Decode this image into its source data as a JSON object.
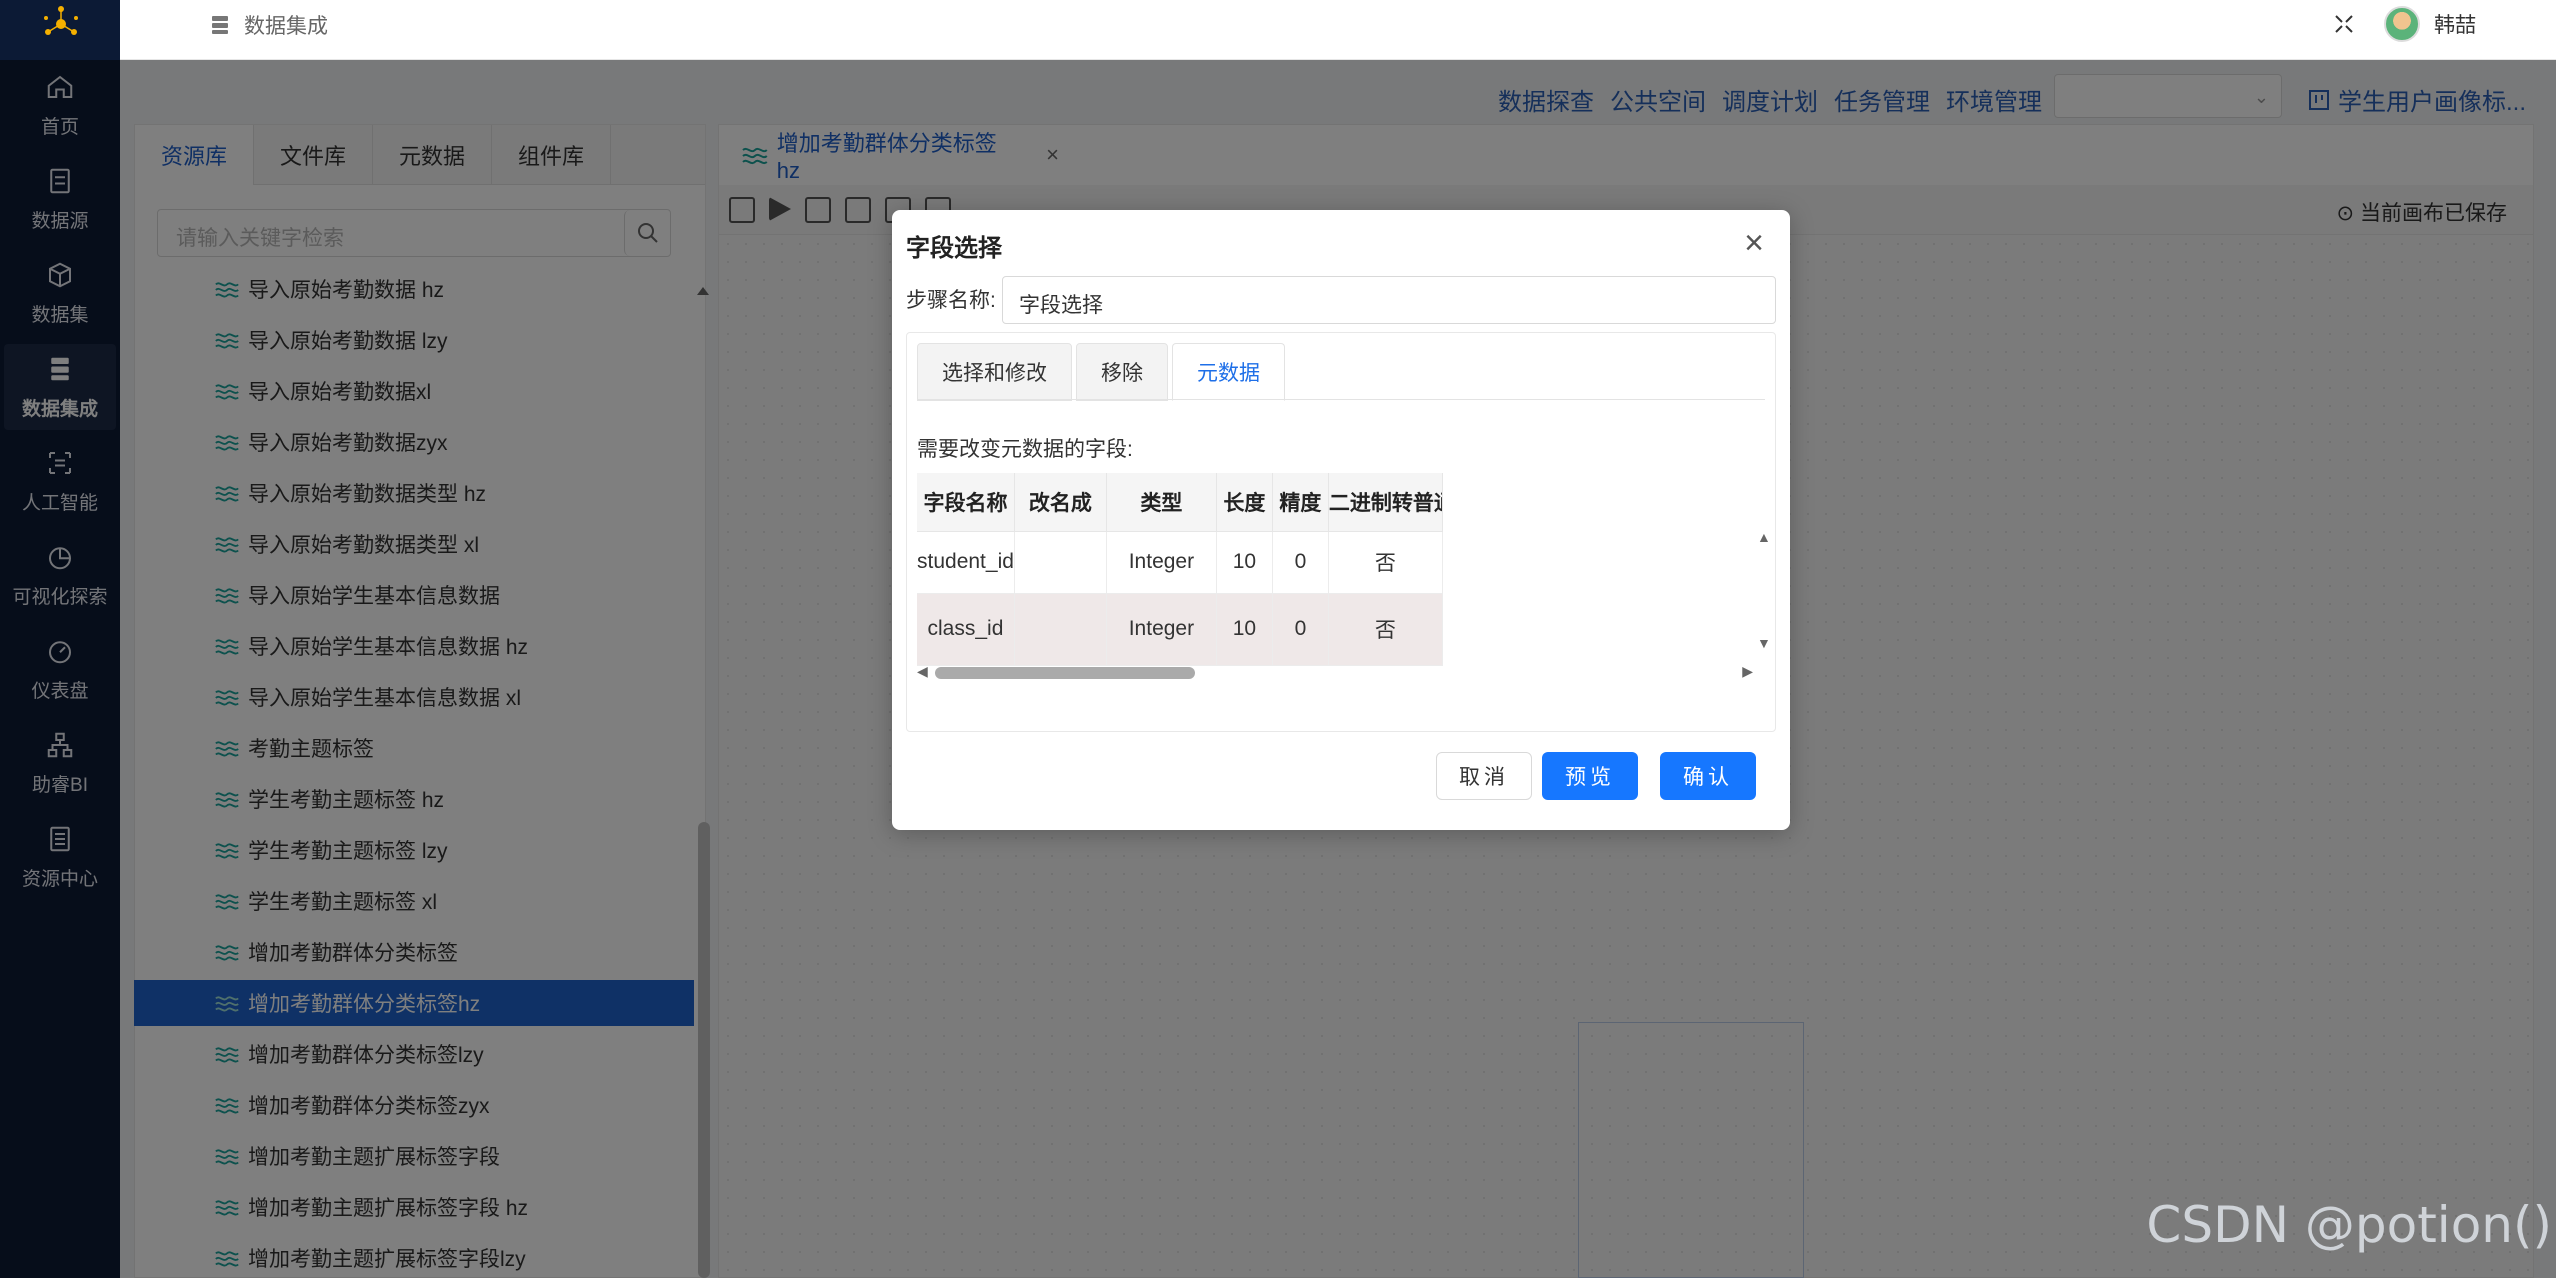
{
  "nav": {
    "items": [
      {
        "label": "首页",
        "icon": "home-icon"
      },
      {
        "label": "数据源",
        "icon": "database-icon"
      },
      {
        "label": "数据集",
        "icon": "cube-icon"
      },
      {
        "label": "数据集成",
        "icon": "server-icon",
        "active": true
      },
      {
        "label": "人工智能",
        "icon": "ai-icon"
      },
      {
        "label": "可视化探索",
        "icon": "pie-chart-icon"
      },
      {
        "label": "仪表盘",
        "icon": "gauge-icon"
      },
      {
        "label": "助睿BI",
        "icon": "org-chart-icon"
      },
      {
        "label": "资源中心",
        "icon": "resource-icon"
      }
    ]
  },
  "topbar": {
    "title": "数据集成",
    "username": "韩喆"
  },
  "subnav": {
    "links": [
      "数据探查",
      "公共空间",
      "调度计划",
      "任务管理",
      "环境管理"
    ],
    "select_value": "",
    "project": "学生用户画像标..."
  },
  "resource": {
    "tabs": [
      "资源库",
      "文件库",
      "元数据",
      "组件库"
    ],
    "search_placeholder": "请输入关键字检索",
    "items": [
      "导入原始考勤数据 hz",
      "导入原始考勤数据 lzy",
      "导入原始考勤数据xl",
      "导入原始考勤数据zyx",
      "导入原始考勤数据类型 hz",
      "导入原始考勤数据类型 xl",
      "导入原始学生基本信息数据",
      "导入原始学生基本信息数据 hz",
      "导入原始学生基本信息数据 xl",
      "考勤主题标签",
      "学生考勤主题标签 hz",
      "学生考勤主题标签 lzy",
      "学生考勤主题标签 xl",
      "增加考勤群体分类标签",
      "增加考勤群体分类标签hz",
      "增加考勤群体分类标签lzy",
      "增加考勤群体分类标签zyx",
      "增加考勤主题扩展标签字段",
      "增加考勤主题扩展标签字段 hz",
      "增加考勤主题扩展标签字段lzy"
    ],
    "selected_index": 14
  },
  "editor": {
    "tab_title": "增加考勤群体分类标签hz",
    "saved_status": "当前画布已保存"
  },
  "modal": {
    "title": "字段选择",
    "step_label": "步骤名称:",
    "step_value": "字段选择",
    "tabs": [
      "选择和修改",
      "移除",
      "元数据"
    ],
    "active_tab": 2,
    "need_label": "需要改变元数据的字段:",
    "table": {
      "headers": [
        "字段名称",
        "改名成",
        "类型",
        "长度",
        "精度",
        "二进制转普通存储"
      ],
      "rows": [
        [
          "student_id",
          "",
          "Integer",
          "10",
          "0",
          "否"
        ],
        [
          "class_id",
          "",
          "Integer",
          "10",
          "0",
          "否"
        ]
      ]
    },
    "buttons": {
      "cancel": "取消",
      "preview": "预览",
      "ok": "确认"
    }
  },
  "watermark": "CSDN @potion()",
  "colors": {
    "accent": "#1677ff",
    "nav_bg": "#0c1a35",
    "selected": "#1f63cc"
  }
}
